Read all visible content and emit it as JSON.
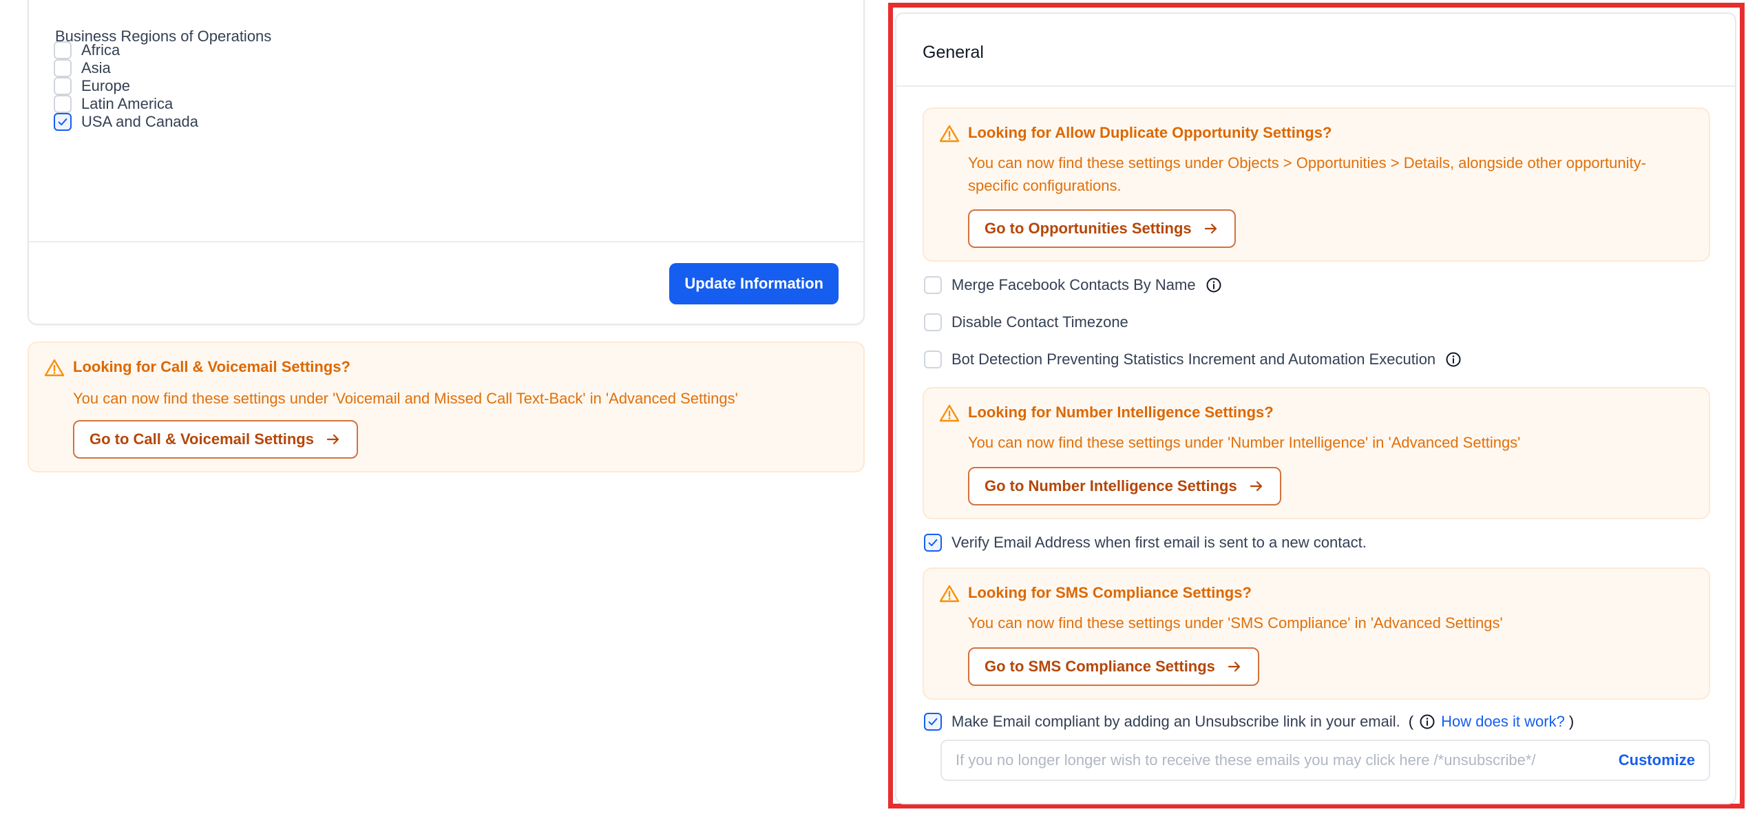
{
  "business_regions": {
    "label": "Business Regions of Operations",
    "items": [
      {
        "label": "Africa",
        "checked": false
      },
      {
        "label": "Asia",
        "checked": false
      },
      {
        "label": "Europe",
        "checked": false
      },
      {
        "label": "Latin America",
        "checked": false
      },
      {
        "label": "USA and Canada",
        "checked": true
      }
    ],
    "update_button": "Update Information"
  },
  "call_voicemail_notice": {
    "title": "Looking for Call & Voicemail Settings?",
    "body": "You can now find these settings under 'Voicemail and Missed Call Text-Back' in 'Advanced Settings'",
    "button": "Go to Call & Voicemail Settings"
  },
  "general": {
    "title": "General",
    "duplicate_opportunity_notice": {
      "title": "Looking for Allow Duplicate Opportunity Settings?",
      "body": "You can now find these settings under Objects > Opportunities > Details, alongside other opportunity-specific configurations.",
      "button": "Go to Opportunities Settings"
    },
    "options": {
      "merge_facebook": {
        "label": "Merge Facebook Contacts By Name",
        "checked": false
      },
      "disable_timezone": {
        "label": "Disable Contact Timezone",
        "checked": false
      },
      "bot_detection": {
        "label": "Bot Detection Preventing Statistics Increment and Automation Execution",
        "checked": false
      },
      "verify_email": {
        "label": "Verify Email Address when first email is sent to a new contact.",
        "checked": true
      },
      "unsubscribe": {
        "label": "Make Email compliant by adding an Unsubscribe link in your email.",
        "checked": true
      }
    },
    "number_intelligence_notice": {
      "title": "Looking for Number Intelligence Settings?",
      "body": "You can now find these settings under 'Number Intelligence' in 'Advanced Settings'",
      "button": "Go to Number Intelligence Settings"
    },
    "sms_compliance_notice": {
      "title": "Looking for SMS Compliance Settings?",
      "body": "You can now find these settings under 'SMS Compliance' in 'Advanced Settings'",
      "button": "Go to SMS Compliance Settings"
    },
    "paren_open": "(",
    "paren_close": ")",
    "how_link": "How does it work?",
    "unsubscribe_placeholder": "If you no longer longer wish to receive these emails you may click here /*unsubscribe*/",
    "customize": "Customize"
  },
  "colors": {
    "primary": "#155eef",
    "warning_text": "#dc6803",
    "notice_bg": "#fff8f0",
    "highlight_frame": "#e62e2e"
  }
}
